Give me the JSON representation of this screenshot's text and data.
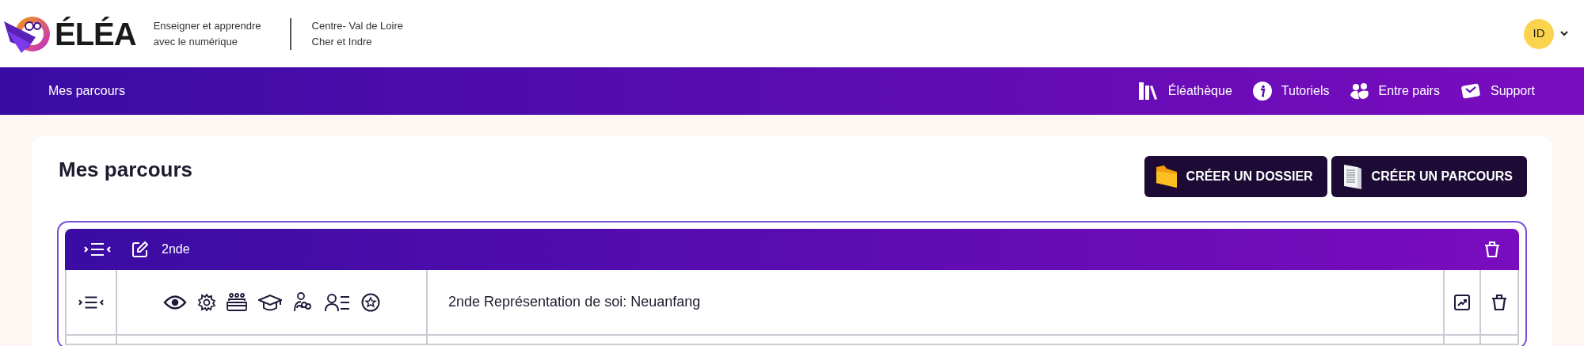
{
  "header": {
    "logo": "ÉLÉA",
    "tagline": [
      "Enseigner et apprendre",
      "avec le numérique"
    ],
    "region": [
      "Centre- Val de Loire",
      "Cher et Indre"
    ],
    "avatar": "ID"
  },
  "nav": {
    "title": "Mes parcours",
    "links": [
      {
        "kind": "books",
        "label": "Éléathèque"
      },
      {
        "kind": "info",
        "label": "Tutoriels"
      },
      {
        "kind": "people",
        "label": "Entre pairs"
      },
      {
        "kind": "mail",
        "label": "Support"
      }
    ]
  },
  "page_title": "Mes parcours",
  "buttons": [
    {
      "kind": "folder",
      "label": "CRÉER UN DOSSIER"
    },
    {
      "kind": "course",
      "label": "CRÉER UN PARCOURS"
    }
  ],
  "folder": {
    "name": "2nde",
    "courses": [
      {
        "title": "2nde Représentation de soi: Neuanfang"
      }
    ]
  }
}
